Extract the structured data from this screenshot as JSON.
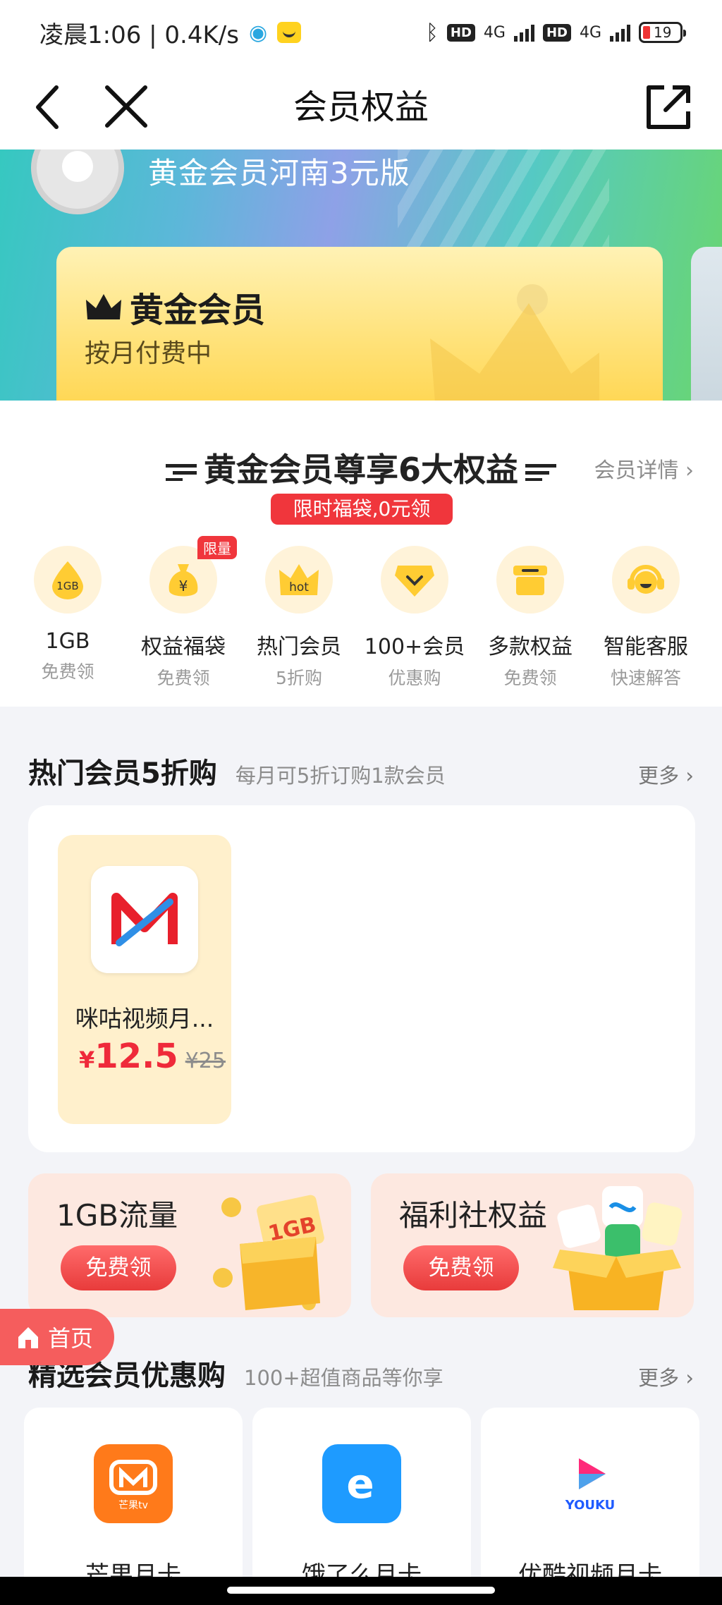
{
  "status_bar": {
    "time_net": "凌晨1:06 | 0.4K/s",
    "hd": "HD",
    "net": "4G",
    "battery": "19"
  },
  "nav": {
    "title": "会员权益"
  },
  "hero": {
    "plan_name": "黄金会员河南3元版",
    "card_title": "黄金会员",
    "card_status": "按月付费中"
  },
  "benefits": {
    "title": "黄金会员尊享6大权益",
    "detail": "会员详情",
    "pill": "限时福袋,0元领",
    "limit_tag": "限量",
    "items": [
      {
        "icon_text": "1GB",
        "name": "1GB",
        "sub": "免费领"
      },
      {
        "icon_text": "¥",
        "name": "权益福袋",
        "sub": "免费领"
      },
      {
        "icon_text": "hot",
        "name": "热门会员",
        "sub": "5折购"
      },
      {
        "icon_text": "",
        "name": "100+会员",
        "sub": "优惠购"
      },
      {
        "icon_text": "",
        "name": "多款权益",
        "sub": "免费领"
      },
      {
        "icon_text": "",
        "name": "智能客服",
        "sub": "快速解答"
      }
    ]
  },
  "hot": {
    "title": "热门会员5折购",
    "sub": "每月可5折订购1款会员",
    "more": "更多",
    "item": {
      "name": "咪咕视频月...",
      "currency": "¥",
      "price": "12.5",
      "old_price": "¥25"
    }
  },
  "promos": [
    {
      "title": "1GB流量",
      "button": "免费领",
      "art_text": "1GB"
    },
    {
      "title": "福利社权益",
      "button": "免费领"
    }
  ],
  "home_float": {
    "label": "首页"
  },
  "selected": {
    "title": "精选会员优惠购",
    "sub": "100+超值商品等你享",
    "more": "更多",
    "items": [
      {
        "name": "芒果月卡",
        "logo_text": "芒果tv",
        "color": "#ff7a1a"
      },
      {
        "name": "饿了么月卡",
        "logo_text": "e",
        "color": "#1e9bff"
      },
      {
        "name": "优酷视频月卡",
        "logo_text": "YOUKU",
        "color": "#ffffff"
      }
    ]
  }
}
